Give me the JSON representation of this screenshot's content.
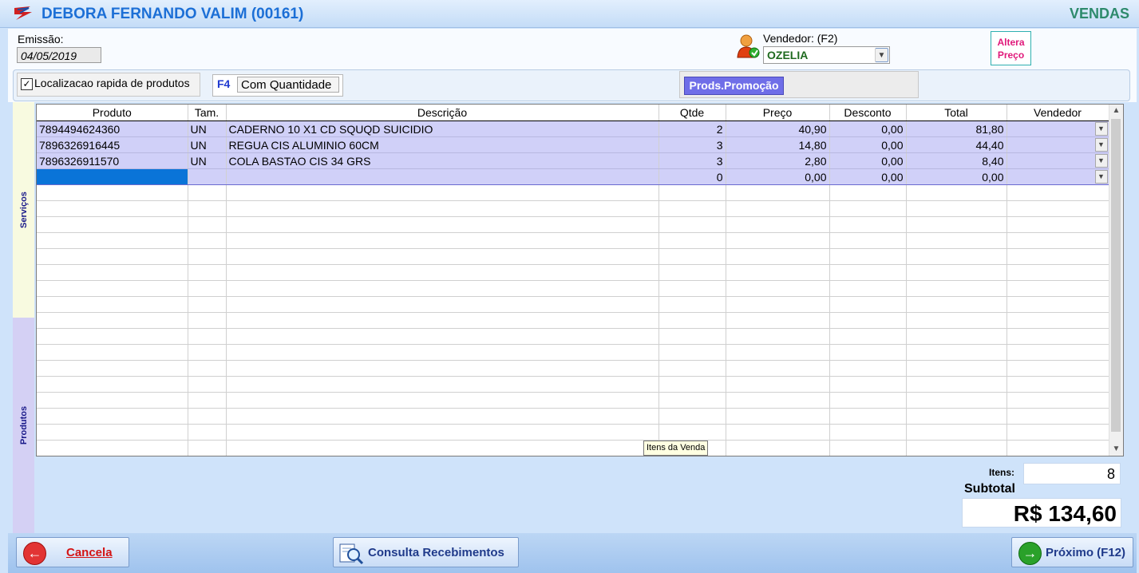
{
  "window": {
    "title": "DEBORA FERNANDO VALIM (00161)",
    "module": "VENDAS"
  },
  "header": {
    "emissao_label": "Emissão:",
    "emissao_value": "04/05/2019",
    "vendedor_label": "Vendedor: (F2)",
    "vendedor_value": "OZELIA",
    "altera_line1": "Altera",
    "altera_line2": "Preço"
  },
  "quickbar": {
    "localizacao_label": "Localizacao rapida de produtos",
    "localizacao_checked": true,
    "f4_key": "F4",
    "f4_button": "Com Quantidade",
    "promo_button": "Prods.Promoção"
  },
  "side_tabs": {
    "servicos": "Serviços",
    "produtos": "Produtos"
  },
  "grid": {
    "columns": [
      "Produto",
      "Tam.",
      "Descrição",
      "Qtde",
      "Preço",
      "Desconto",
      "Total",
      "Vendedor"
    ],
    "rows": [
      {
        "produto": "7894494624360",
        "tam": "UN",
        "descricao": "CADERNO 10 X1 CD SQUQD SUICIDIO",
        "qtde": "2",
        "preco": "40,90",
        "desconto": "0,00",
        "total": "81,80",
        "vendedor": ""
      },
      {
        "produto": "7896326916445",
        "tam": "UN",
        "descricao": "REGUA CIS ALUMINIO 60CM",
        "qtde": "3",
        "preco": "14,80",
        "desconto": "0,00",
        "total": "44,40",
        "vendedor": ""
      },
      {
        "produto": "7896326911570",
        "tam": "UN",
        "descricao": "COLA BASTAO CIS 34 GRS",
        "qtde": "3",
        "preco": "2,80",
        "desconto": "0,00",
        "total": "8,40",
        "vendedor": ""
      }
    ],
    "new_row": {
      "produto": "",
      "tam": "",
      "descricao": "",
      "qtde": "0",
      "preco": "0,00",
      "desconto": "0,00",
      "total": "0,00",
      "vendedor": ""
    },
    "tooltip": "Itens da Venda"
  },
  "totals": {
    "itens_label": "Itens:",
    "itens_value": "8",
    "subtotal_label": "Subtotal",
    "subtotal_value": "R$ 134,60"
  },
  "bottom": {
    "cancel_label": "Cancela",
    "consulta_label": "Consulta Recebimentos",
    "next_label": "Próximo (F12)"
  },
  "colors": {
    "title": "#1c6fd6",
    "module": "#2d8a6c",
    "promo": "#6f6ee8",
    "selected_cell": "#0a74d8",
    "row_highlight": "#d0d0f8"
  },
  "icons": [
    "app-logo-icon",
    "user-icon",
    "chevron-down-icon",
    "cancel-icon",
    "search-document-icon",
    "next-arrow-icon"
  ]
}
